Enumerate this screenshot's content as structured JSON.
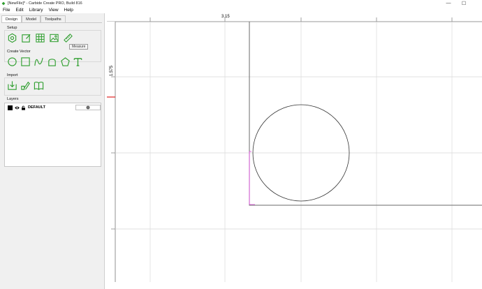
{
  "window": {
    "title": "[NewFile]* - Carbide Create PRO, Build 816",
    "minimize_glyph": "—",
    "maximize_glyph": "☐"
  },
  "menu": [
    "File",
    "Edit",
    "Library",
    "View",
    "Help"
  ],
  "panel": {
    "tabs": [
      "Design",
      "Model",
      "Toolpaths"
    ],
    "active_tab": "Design",
    "sections": {
      "setup": "Setup",
      "create_vector": "Create Vector",
      "import": "Import",
      "layers": "Layers"
    },
    "tooltip": "Measure",
    "setup_tools": [
      "job-setup-icon",
      "edit-icon",
      "grid-icon",
      "image-icon",
      "measure-icon"
    ],
    "vector_tools": [
      "circle-icon",
      "rectangle-icon",
      "curve-icon",
      "polygon-shape-icon",
      "pentagon-icon",
      "text-icon"
    ],
    "import_tools": [
      "import-icon",
      "import-vector-icon",
      "library-book-icon"
    ],
    "layer": {
      "name": "DEFAULT",
      "color": "#000000"
    }
  },
  "canvas": {
    "ruler_top_value": "3.15",
    "ruler_left_value": "1.575",
    "accent_color": "#2e9e2e",
    "origin_marker_color": "#e02020",
    "pink_guide_color": "#e040e0"
  }
}
